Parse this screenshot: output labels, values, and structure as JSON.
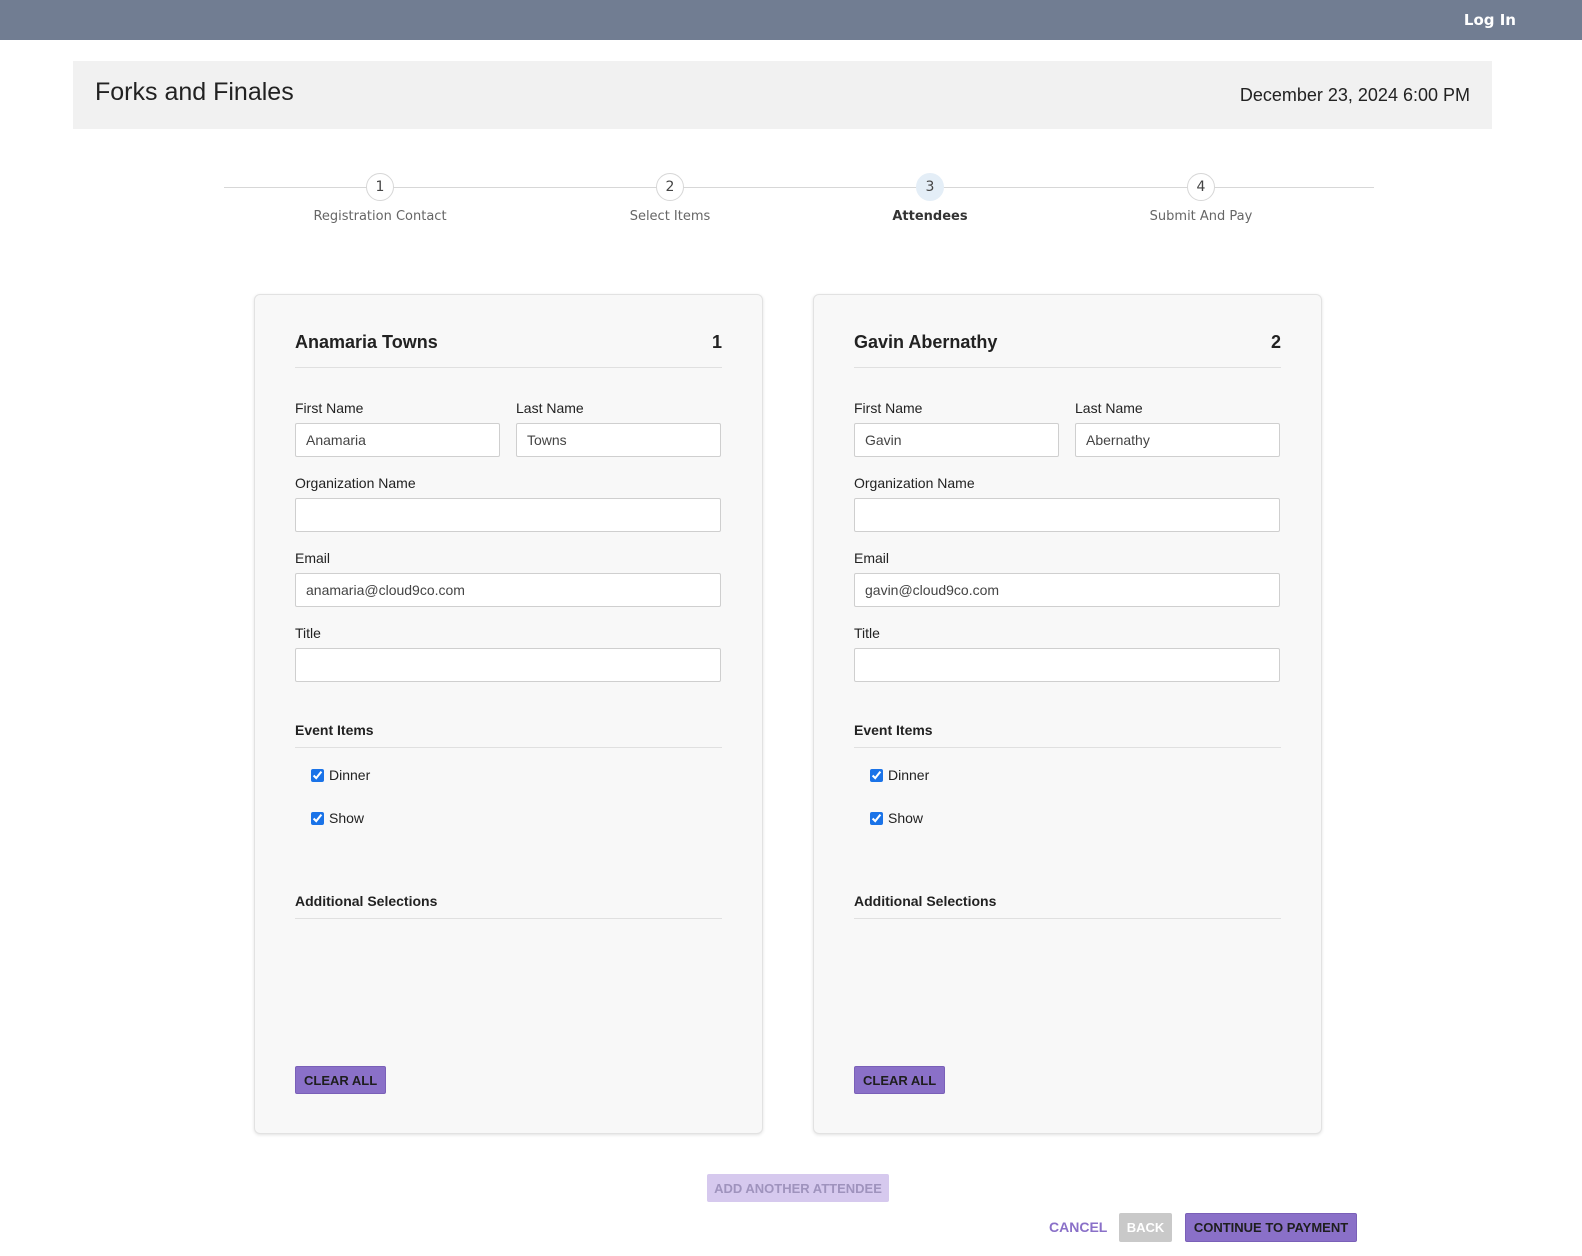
{
  "topbar": {
    "login_label": "Log In"
  },
  "event": {
    "title": "Forks and Finales",
    "date": "December 23, 2024 6:00 PM"
  },
  "steps": [
    {
      "number": "1",
      "label": "Registration Contact",
      "active": false
    },
    {
      "number": "2",
      "label": "Select Items",
      "active": false
    },
    {
      "number": "3",
      "label": "Attendees",
      "active": true
    },
    {
      "number": "4",
      "label": "Submit And Pay",
      "active": false
    }
  ],
  "form_labels": {
    "first_name": "First Name",
    "last_name": "Last Name",
    "organization": "Organization Name",
    "email": "Email",
    "title": "Title",
    "event_items": "Event Items",
    "additional_selections": "Additional Selections",
    "clear_all": "CLEAR ALL"
  },
  "attendees": [
    {
      "display_name": "Anamaria Towns",
      "number": "1",
      "first_name": "Anamaria",
      "last_name": "Towns",
      "organization": "",
      "email": "anamaria@cloud9co.com",
      "title": "",
      "items": [
        {
          "label": "Dinner",
          "checked": true
        },
        {
          "label": "Show",
          "checked": true
        }
      ]
    },
    {
      "display_name": "Gavin Abernathy",
      "number": "2",
      "first_name": "Gavin",
      "last_name": "Abernathy",
      "organization": "",
      "email": "gavin@cloud9co.com",
      "title": "",
      "items": [
        {
          "label": "Dinner",
          "checked": true
        },
        {
          "label": "Show",
          "checked": true
        }
      ]
    }
  ],
  "actions": {
    "add_attendee": "ADD ANOTHER ATTENDEE",
    "cancel": "CANCEL",
    "back": "BACK",
    "continue": "CONTINUE TO PAYMENT"
  },
  "colors": {
    "topbar": "#717d92",
    "accent": "#8a70c8",
    "accent_disabled": "#d6c9ee",
    "header_bg": "#f1f1f1",
    "card_bg": "#f8f8f8"
  }
}
